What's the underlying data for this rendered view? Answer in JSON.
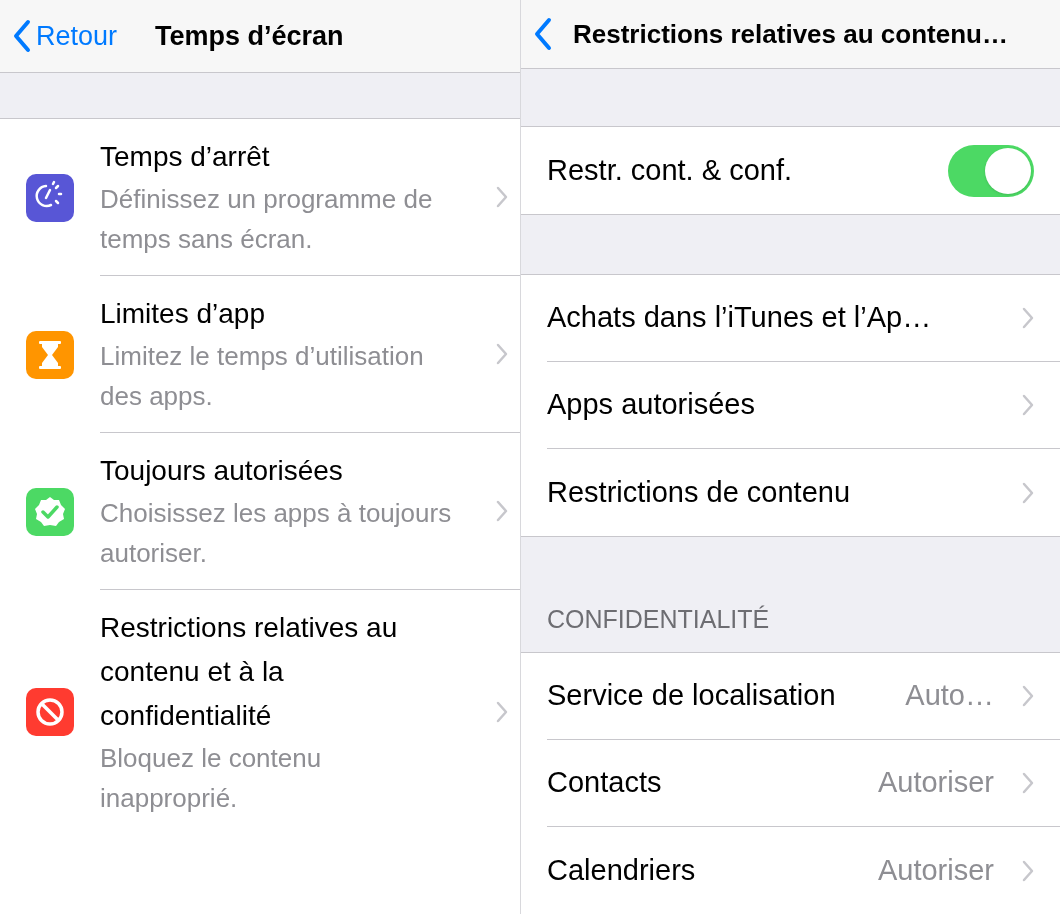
{
  "left": {
    "nav": {
      "back": "Retour",
      "title": "Temps d’écran"
    },
    "items": [
      {
        "kind": "downtime",
        "color": "#5856d6",
        "title": "Temps d’arrêt",
        "subtitle": "Définissez un programme de temps sans écran."
      },
      {
        "kind": "hourglass",
        "color": "#ff9500",
        "title": "Limites d’app",
        "subtitle": "Limitez le temps d’utilisation des apps."
      },
      {
        "kind": "check",
        "color": "#4cd964",
        "title": "Toujours autorisées",
        "subtitle": "Choisissez les apps à toujours autoriser."
      },
      {
        "kind": "block",
        "color": "#ff3b30",
        "title": "Restrictions relatives au contenu et à la confidentialité",
        "subtitle": "Bloquez le contenu inapproprié."
      }
    ]
  },
  "right": {
    "nav": {
      "title": "Restrictions relatives au contenu…"
    },
    "groups": [
      {
        "rows": [
          {
            "kind": "toggle",
            "label": "Restr. cont. & conf.",
            "on": true
          }
        ]
      },
      {
        "rows": [
          {
            "kind": "link",
            "label": "Achats dans l’iTunes et l’Ap…"
          },
          {
            "kind": "link",
            "label": "Apps autorisées"
          },
          {
            "kind": "link",
            "label": "Restrictions de contenu"
          }
        ]
      },
      {
        "header": "CONFIDENTIALITÉ",
        "rows": [
          {
            "kind": "link",
            "label": "Service de localisation",
            "value": "Auto…"
          },
          {
            "kind": "link",
            "label": "Contacts",
            "value": "Autoriser"
          },
          {
            "kind": "link",
            "label": "Calendriers",
            "value": "Autoriser"
          }
        ]
      }
    ]
  }
}
